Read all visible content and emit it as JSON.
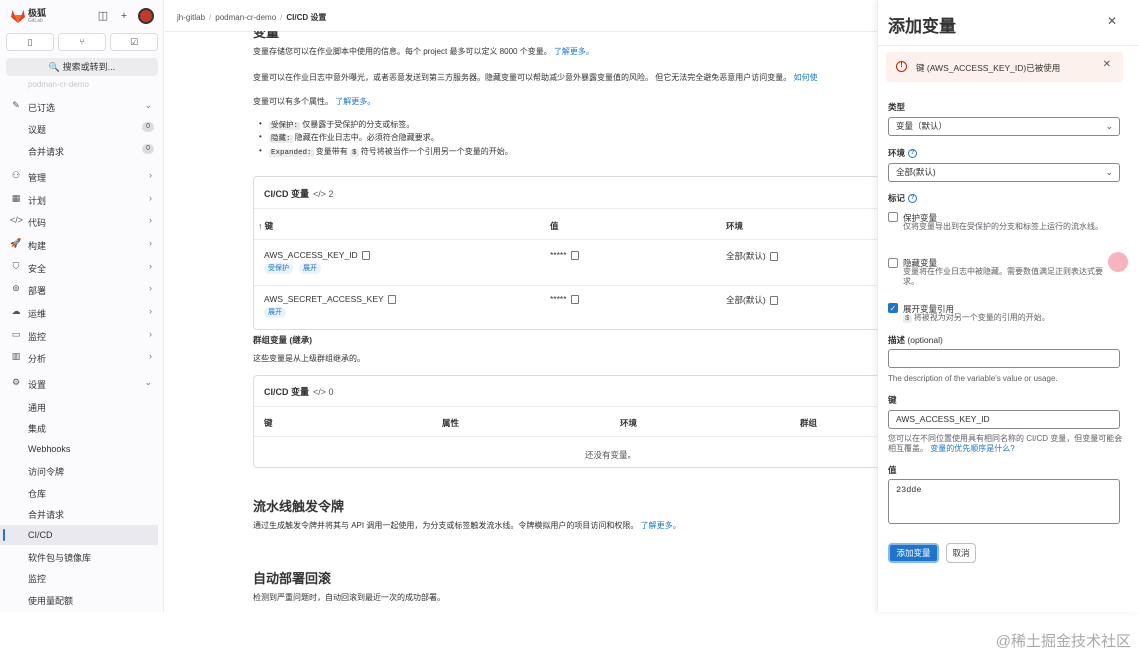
{
  "app": {
    "brand_name": "极狐",
    "brand_sub": "GitLab"
  },
  "sidebar": {
    "search_label": "🔍 搜索或转到...",
    "faded_project": "podman-cr-demo",
    "tab_icons": [
      "issues-icon",
      "merge-request-icon",
      "todo-icon"
    ],
    "pinned": {
      "label": "已订选",
      "items": [
        {
          "label": "议题",
          "count": "0"
        },
        {
          "label": "合并请求",
          "count": "0"
        }
      ]
    },
    "items": [
      {
        "label": "管理",
        "icon": "manage-icon"
      },
      {
        "label": "计划",
        "icon": "plan-icon"
      },
      {
        "label": "代码",
        "icon": "code-icon"
      },
      {
        "label": "构建",
        "icon": "build-icon"
      },
      {
        "label": "安全",
        "icon": "shield-icon"
      },
      {
        "label": "部署",
        "icon": "deploy-icon"
      },
      {
        "label": "运维",
        "icon": "operate-icon"
      },
      {
        "label": "监控",
        "icon": "monitor-icon"
      },
      {
        "label": "分析",
        "icon": "analytics-icon"
      }
    ],
    "settings": {
      "label": "设置",
      "subitems": [
        "通用",
        "集成",
        "Webhooks",
        "访问令牌",
        "仓库",
        "合并请求",
        "CI/CD",
        "软件包与镜像库",
        "监控",
        "使用量配额"
      ],
      "active": "CI/CD"
    }
  },
  "breadcrumb": {
    "items": [
      "jh-gitlab",
      "podman-cr-demo",
      "CI/CD 设置"
    ]
  },
  "variables": {
    "title": "变量",
    "desc1": "变量存储您可以在作业脚本中使用的信息。每个 project 最多可以定义 8000 个变量。",
    "learn_more1": "了解更多。",
    "desc2": "变量可以在作业日志中意外曝光，或者恶意发送到第三方服务器。隐藏变量可以帮助减少意外暴露变量值的风险。 但它无法完全避免恶意用户访问变量。",
    "learn_more2": "如何使",
    "desc3": "变量可以有多个属性。",
    "learn_more3": "了解更多。",
    "bullets": [
      {
        "code": "受保护:",
        "text": "仅暴露于受保护的分支或标签。"
      },
      {
        "code": "隐藏:",
        "text": "隐藏在作业日志中。必须符合隐藏要求。"
      },
      {
        "code": "Expanded:",
        "text": "变量带有",
        "code2": "$",
        "text2": "符号将被当作一个引用另一个变量的开始。"
      }
    ],
    "table": {
      "title": "CI/CD 变量",
      "count": "</> 2",
      "headers": [
        "↑ 键",
        "值",
        "环境"
      ],
      "rows": [
        {
          "key": "AWS_ACCESS_KEY_ID",
          "value": "*****",
          "env": "全部(默认)",
          "badges": [
            "受保护",
            "展开"
          ]
        },
        {
          "key": "AWS_SECRET_ACCESS_KEY",
          "value": "*****",
          "env": "全部(默认)",
          "badges": [
            "展开"
          ]
        }
      ]
    }
  },
  "group_vars": {
    "title": "群组变量 (继承)",
    "desc": "这些变量是从上级群组继承的。",
    "table": {
      "title": "CI/CD 变量",
      "count": "</> 0",
      "headers": [
        "键",
        "属性",
        "环境",
        "群组"
      ],
      "empty": "还没有变量。"
    }
  },
  "trigger": {
    "title": "流水线触发令牌",
    "desc": "通过生成触发令牌并将其与 API 调用一起使用，为分支或标签触发流水线。令牌模拟用户的项目访问和权限。",
    "learn_more": "了解更多。"
  },
  "rollback": {
    "title": "自动部署回滚",
    "desc": "检测到严重问题时，自动回滚到最近一次的成功部署。"
  },
  "drawer": {
    "title": "添加变量",
    "alert": "键 (AWS_ACCESS_KEY_ID)已被使用",
    "type_label": "类型",
    "type_value": "变量（默认）",
    "env_label": "环境",
    "env_value": "全部(默认)",
    "flags_label": "标记",
    "flags": [
      {
        "label": "保护变量",
        "help": "仅将变量导出到在受保护的分支和标签上运行的流水线。",
        "checked": false
      },
      {
        "label": "隐藏变量",
        "help": "变量将在作业日志中被隐藏。需要数值满足正则表达式要求。",
        "checked": false
      },
      {
        "label": "展开变量引用",
        "help_code": "$",
        "help": "将被视为对另一个变量的引用的开始。",
        "checked": true
      }
    ],
    "desc_label": "描述",
    "desc_optional": "(optional)",
    "desc_value": "",
    "desc_hint": "The description of the variable's value or usage.",
    "key_label": "键",
    "key_value": "AWS_ACCESS_KEY_ID",
    "key_hint": "您可以在不同位置使用具有相同名称的 CI/CD 变量，但变量可能会相互覆盖。",
    "key_hint_link": "变量的优先顺序是什么?",
    "value_label": "值",
    "value_value": "23dde",
    "add_button": "添加变量",
    "cancel_button": "取消"
  },
  "watermark": "@稀土掘金技术社区"
}
